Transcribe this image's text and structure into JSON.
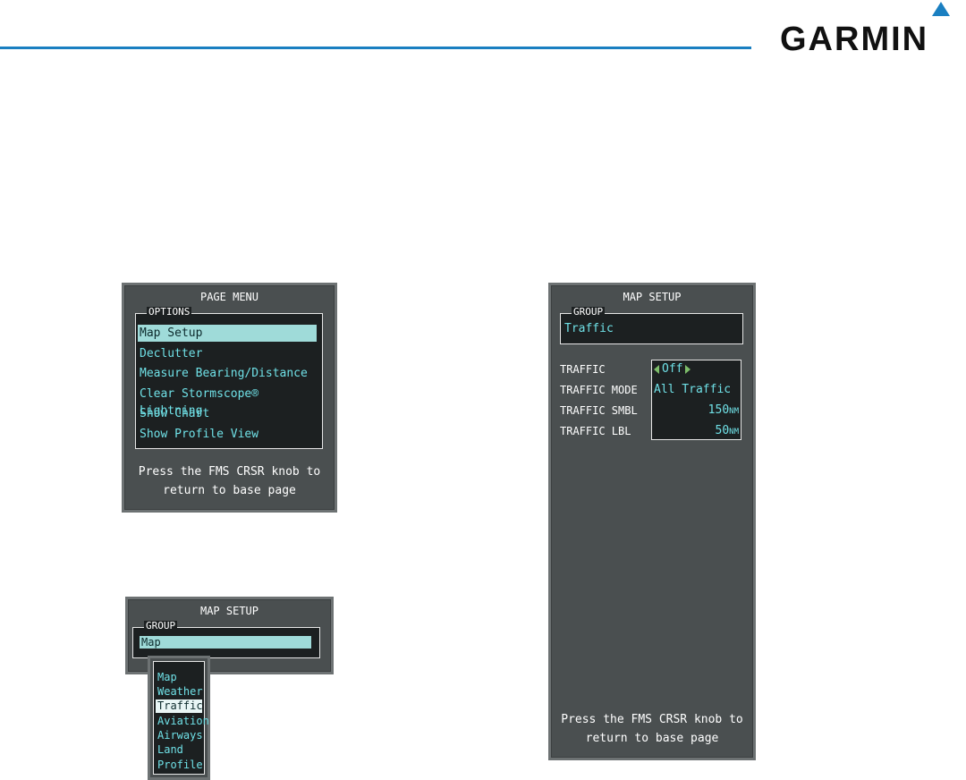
{
  "brand": {
    "name": "GARMIN",
    "accent_color": "#1a7fc1"
  },
  "page_menu": {
    "title": "PAGE MENU",
    "options_label": "OPTIONS",
    "items": [
      {
        "label": "Map Setup",
        "selected": true
      },
      {
        "label": "Declutter",
        "selected": false
      },
      {
        "label": "Measure Bearing/Distance",
        "selected": false
      },
      {
        "label": "Clear Stormscope® Lightning",
        "selected": false
      },
      {
        "label": "Show Chart",
        "selected": false
      },
      {
        "label": "Show Profile View",
        "selected": false
      }
    ],
    "footer_line1": "Press the FMS CRSR knob to",
    "footer_line2": "return to base page"
  },
  "map_setup_small": {
    "title": "MAP SETUP",
    "group_label": "GROUP",
    "group_value": "Map",
    "dropdown": [
      {
        "label": "Map",
        "selected": false
      },
      {
        "label": "Weather",
        "selected": false
      },
      {
        "label": "Traffic",
        "selected": true
      },
      {
        "label": "Aviation",
        "selected": false
      },
      {
        "label": "Airways",
        "selected": false
      },
      {
        "label": "Land",
        "selected": false
      },
      {
        "label": "Profile",
        "selected": false
      }
    ]
  },
  "map_setup_traffic": {
    "title": "MAP SETUP",
    "group_label": "GROUP",
    "group_value": "Traffic",
    "settings": [
      {
        "label": "TRAFFIC",
        "value": "Off",
        "unit": ""
      },
      {
        "label": "TRAFFIC MODE",
        "value": "All Traffic",
        "unit": ""
      },
      {
        "label": "TRAFFIC SMBL",
        "value": "150",
        "unit": "NM"
      },
      {
        "label": "TRAFFIC LBL",
        "value": "50",
        "unit": "NM"
      }
    ],
    "footer_line1": "Press the FMS CRSR knob to",
    "footer_line2": "return to base page"
  }
}
